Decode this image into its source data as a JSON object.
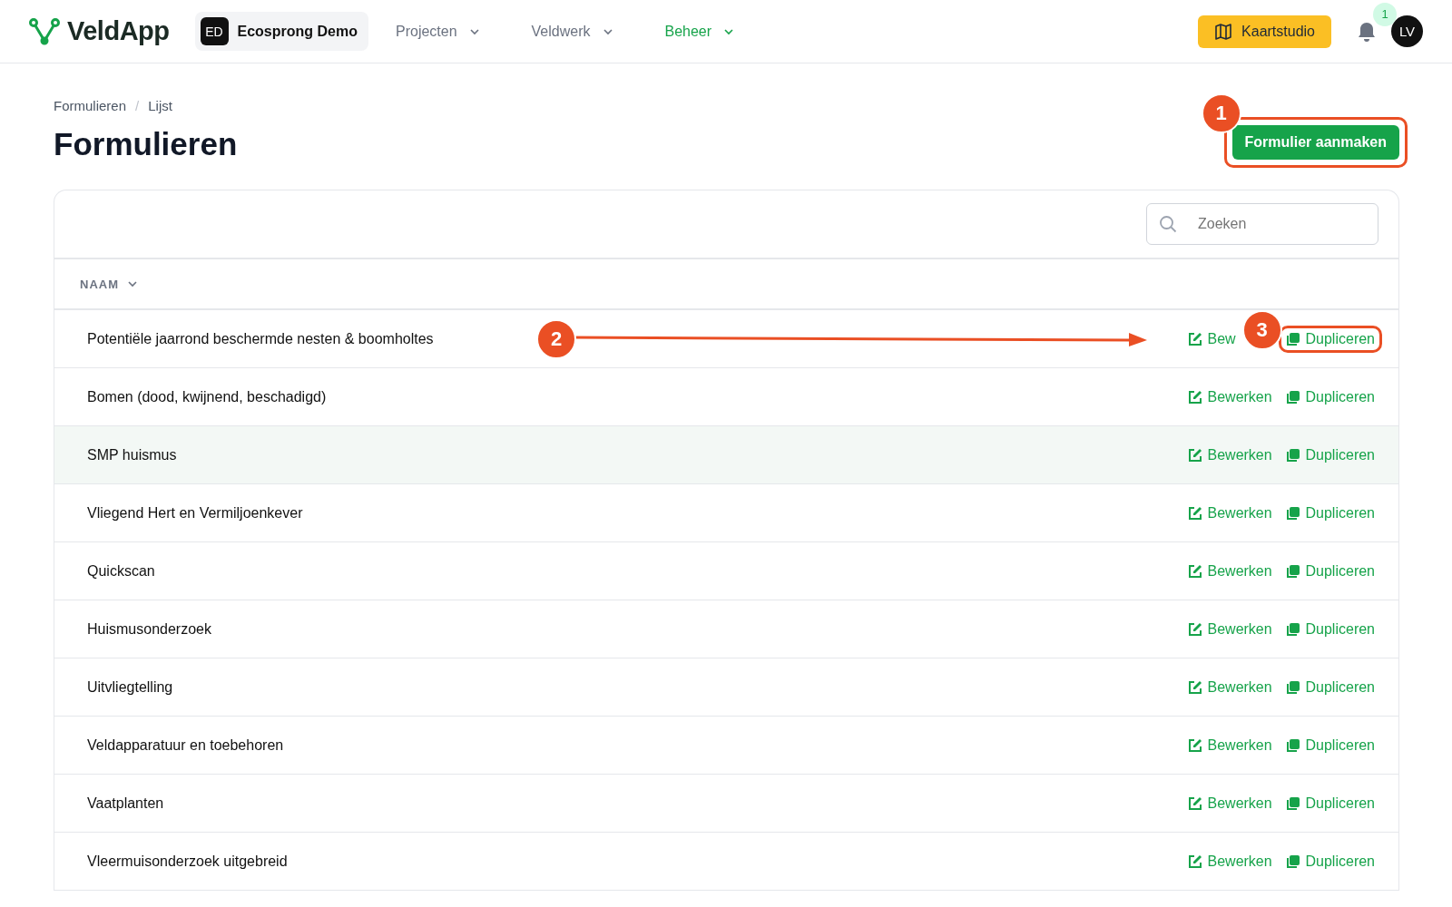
{
  "topbar": {
    "brand": "VeldApp",
    "org": {
      "initials": "ED",
      "name": "Ecosprong Demo"
    },
    "nav": [
      {
        "label": "Projecten",
        "selected": false
      },
      {
        "label": "Veldwerk",
        "selected": false
      },
      {
        "label": "Beheer",
        "selected": true
      }
    ],
    "studio_button": "Kaartstudio",
    "notifications": "1",
    "avatar": "LV"
  },
  "breadcrumb": {
    "items": [
      "Formulieren",
      "Lijst"
    ],
    "separator": "/"
  },
  "title": "Formulieren",
  "create_button": {
    "label": "Formulier aanmaken",
    "highlighted": true,
    "marker": "1"
  },
  "search": {
    "placeholder": "Zoeken"
  },
  "column": "NAAM",
  "rows": [
    {
      "name": "Potentiële jaarrond beschermde nesten & boomholtes",
      "hovered": false,
      "marker": "2",
      "arrow": true,
      "edit": {
        "label": "Bew"
      },
      "duplicate": {
        "label": "Dupliceren",
        "highlighted": true,
        "marker": "3"
      }
    },
    {
      "name": "Bomen (dood, kwijnend, beschadigd)",
      "hovered": false,
      "edit": {
        "label": "Bewerken"
      },
      "duplicate": {
        "label": "Dupliceren",
        "highlighted": false
      }
    },
    {
      "name": "SMP huismus",
      "hovered": true,
      "edit": {
        "label": "Bewerken"
      },
      "duplicate": {
        "label": "Dupliceren",
        "highlighted": false
      }
    },
    {
      "name": "Vliegend Hert en Vermiljoenkever",
      "hovered": false,
      "edit": {
        "label": "Bewerken"
      },
      "duplicate": {
        "label": "Dupliceren",
        "highlighted": false
      }
    },
    {
      "name": "Quickscan",
      "hovered": false,
      "edit": {
        "label": "Bewerken"
      },
      "duplicate": {
        "label": "Dupliceren",
        "highlighted": false
      }
    },
    {
      "name": "Huismusonderzoek",
      "hovered": false,
      "edit": {
        "label": "Bewerken"
      },
      "duplicate": {
        "label": "Dupliceren",
        "highlighted": false
      }
    },
    {
      "name": "Uitvliegtelling",
      "hovered": false,
      "edit": {
        "label": "Bewerken"
      },
      "duplicate": {
        "label": "Dupliceren",
        "highlighted": false
      }
    },
    {
      "name": "Veldapparatuur en toebehoren",
      "hovered": false,
      "edit": {
        "label": "Bewerken"
      },
      "duplicate": {
        "label": "Dupliceren",
        "highlighted": false
      }
    },
    {
      "name": "Vaatplanten",
      "hovered": false,
      "edit": {
        "label": "Bewerken"
      },
      "duplicate": {
        "label": "Dupliceren",
        "highlighted": false
      }
    },
    {
      "name": "Vleermuisonderzoek uitgebreid",
      "hovered": false,
      "edit": {
        "label": "Bewerken"
      },
      "duplicate": {
        "label": "Dupliceren",
        "highlighted": false
      }
    }
  ]
}
